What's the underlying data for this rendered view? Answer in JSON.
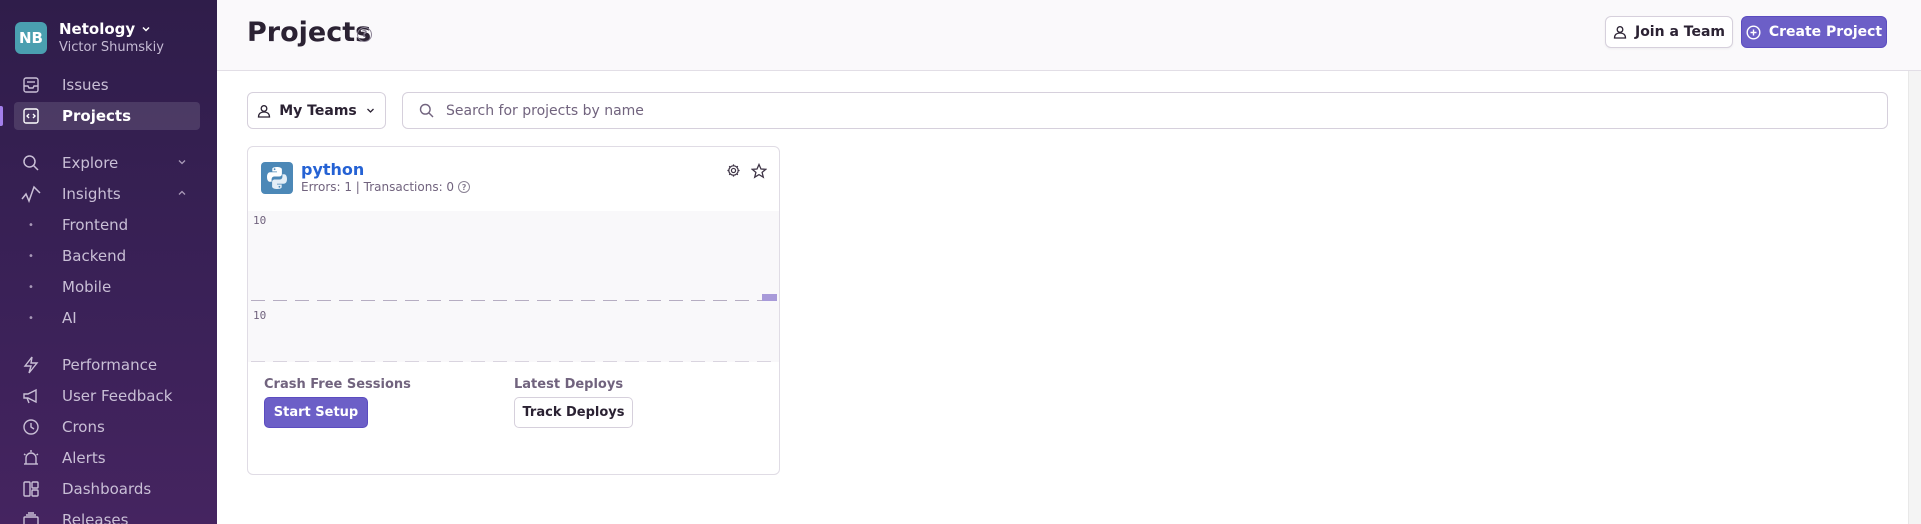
{
  "org": {
    "initials": "NB",
    "name": "Netology",
    "user": "Victor Shumskiy"
  },
  "sidebar": {
    "items": [
      {
        "label": "Issues",
        "icon": "inbox-icon"
      },
      {
        "label": "Projects",
        "icon": "projects-icon",
        "active": true
      },
      {
        "label": "Explore",
        "icon": "search-icon"
      },
      {
        "label": "Insights",
        "icon": "insights-graph-icon"
      },
      {
        "label": "Frontend"
      },
      {
        "label": "Backend"
      },
      {
        "label": "Mobile"
      },
      {
        "label": "AI"
      },
      {
        "label": "Performance",
        "icon": "lightning-icon"
      },
      {
        "label": "User Feedback",
        "icon": "megaphone-icon"
      },
      {
        "label": "Crons",
        "icon": "history-clock-icon"
      },
      {
        "label": "Alerts",
        "icon": "siren-icon"
      },
      {
        "label": "Dashboards",
        "icon": "dashboard-icon"
      },
      {
        "label": "Releases",
        "icon": "releases-icon"
      }
    ]
  },
  "header": {
    "title": "Projects",
    "join_team_label": "Join a Team",
    "create_project_label": "Create Project"
  },
  "filters": {
    "teams_label": "My Teams",
    "search_placeholder": "Search for projects by name"
  },
  "project_card": {
    "name": "python",
    "stats": "Errors: 1 | Transactions: 0",
    "chart_top_label": "10",
    "chart_bottom_label": "10",
    "crash_free_label": "Crash Free Sessions",
    "start_setup_label": "Start Setup",
    "latest_deploys_label": "Latest Deploys",
    "track_deploys_label": "Track Deploys"
  },
  "colors": {
    "accent": "#6c5fc7",
    "sidebar": "#3a2157",
    "link": "#2562d4"
  }
}
